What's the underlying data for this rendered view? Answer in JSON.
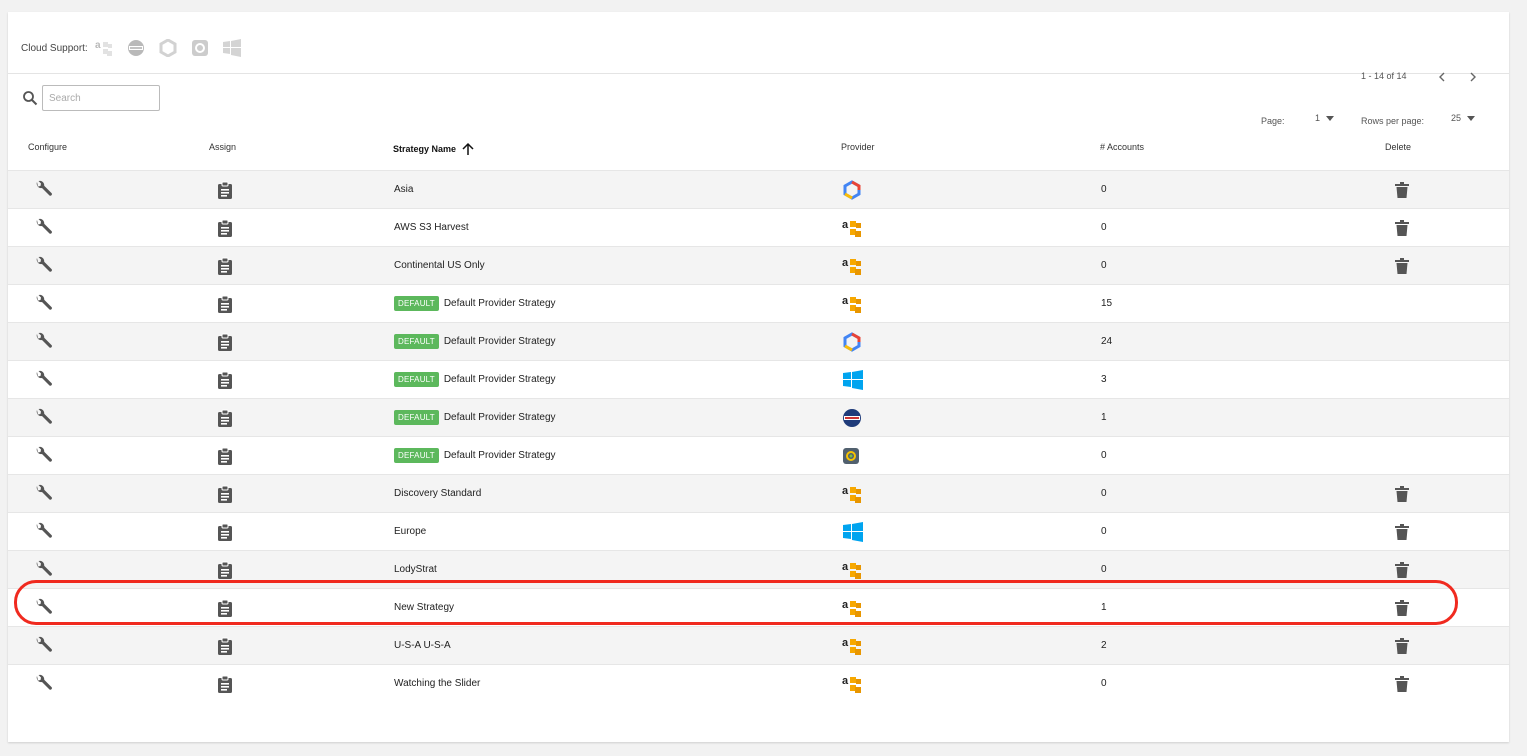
{
  "cloud_support": {
    "label": "Cloud Support:",
    "icons": [
      "aws-icon",
      "ibm-globe-icon",
      "google-cloud-icon",
      "vmware-icon",
      "azure-windows-icon"
    ]
  },
  "search": {
    "placeholder": "Search",
    "value": ""
  },
  "pagination": {
    "range_text": "1 - 14 of 14",
    "page_label": "Page:",
    "page_value": "1",
    "rows_label": "Rows per page:",
    "rows_value": "25"
  },
  "columns": {
    "configure": "Configure",
    "assign": "Assign",
    "name": "Strategy Name",
    "provider": "Provider",
    "accounts": "# Accounts",
    "delete": "Delete"
  },
  "default_badge_label": "DEFAULT",
  "rows": [
    {
      "name": "Asia",
      "provider": "google",
      "accounts": "0",
      "is_default": false,
      "deletable": true
    },
    {
      "name": "AWS S3 Harvest",
      "provider": "aws",
      "accounts": "0",
      "is_default": false,
      "deletable": true
    },
    {
      "name": "Continental US Only",
      "provider": "aws",
      "accounts": "0",
      "is_default": false,
      "deletable": true
    },
    {
      "name": "Default Provider Strategy",
      "provider": "aws",
      "accounts": "15",
      "is_default": true,
      "deletable": false
    },
    {
      "name": "Default Provider Strategy",
      "provider": "google",
      "accounts": "24",
      "is_default": true,
      "deletable": false
    },
    {
      "name": "Default Provider Strategy",
      "provider": "azure",
      "accounts": "3",
      "is_default": true,
      "deletable": false
    },
    {
      "name": "Default Provider Strategy",
      "provider": "ibm",
      "accounts": "1",
      "is_default": true,
      "deletable": false
    },
    {
      "name": "Default Provider Strategy",
      "provider": "vmware",
      "accounts": "0",
      "is_default": true,
      "deletable": false
    },
    {
      "name": "Discovery Standard",
      "provider": "aws",
      "accounts": "0",
      "is_default": false,
      "deletable": true
    },
    {
      "name": "Europe",
      "provider": "azure",
      "accounts": "0",
      "is_default": false,
      "deletable": true
    },
    {
      "name": "LodyStrat",
      "provider": "aws",
      "accounts": "0",
      "is_default": false,
      "deletable": true
    },
    {
      "name": "New Strategy",
      "provider": "aws",
      "accounts": "1",
      "is_default": false,
      "deletable": true,
      "highlighted": true
    },
    {
      "name": "U-S-A U-S-A",
      "provider": "aws",
      "accounts": "2",
      "is_default": false,
      "deletable": true
    },
    {
      "name": "Watching the Slider",
      "provider": "aws",
      "accounts": "0",
      "is_default": false,
      "deletable": true
    }
  ],
  "colors": {
    "default_badge": "#5cb85c",
    "highlight_ring": "#f02a1f",
    "row_alt_bg": "#f4f4f4"
  }
}
